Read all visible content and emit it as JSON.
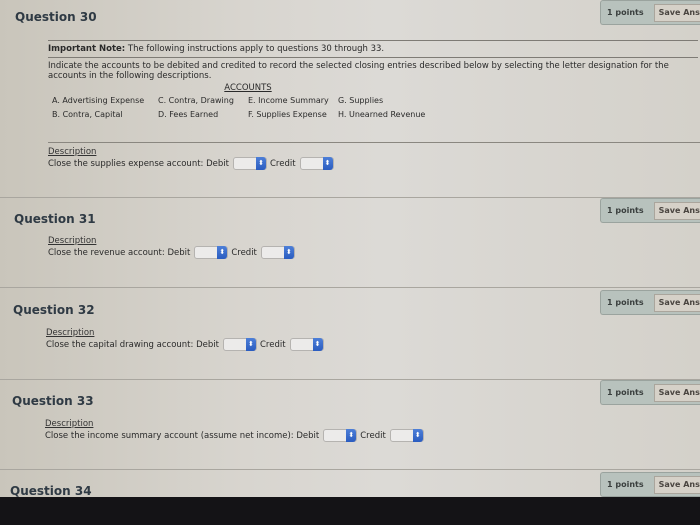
{
  "questions": [
    {
      "title": "Question 30",
      "points": "1 points",
      "save_label": "Save Answer",
      "description_label": "Description",
      "prompt": "Close the supplies expense account:",
      "debit_label": "Debit",
      "credit_label": "Credit",
      "debit_value": "",
      "credit_value": ""
    },
    {
      "title": "Question 31",
      "points": "1 points",
      "save_label": "Save Answer",
      "description_label": "Description",
      "prompt": "Close the revenue account:",
      "debit_label": "Debit",
      "credit_label": "Credit",
      "debit_value": "",
      "credit_value": ""
    },
    {
      "title": "Question 32",
      "points": "1 points",
      "save_label": "Save Answer",
      "description_label": "Description",
      "prompt": "Close the capital drawing account:",
      "debit_label": "Debit",
      "credit_label": "Credit",
      "debit_value": "",
      "credit_value": ""
    },
    {
      "title": "Question 33",
      "points": "1 points",
      "save_label": "Save Answer",
      "description_label": "Description",
      "prompt": "Close the income summary account (assume net income):",
      "debit_label": "Debit",
      "credit_label": "Credit",
      "debit_value": "",
      "credit_value": ""
    },
    {
      "title": "Question 34",
      "points": "1 points",
      "save_label": "Save Answer"
    }
  ],
  "note": {
    "bold": "Important Note:",
    "text": " The following instructions apply to questions 30 through 33."
  },
  "instructions": "Indicate the accounts to be debited and credited to record the selected closing entries described below by selecting the letter designation for the accounts in the following descriptions.",
  "accounts": {
    "title": "ACCOUNTS",
    "items": [
      "A. Advertising Expense",
      "C. Contra, Drawing",
      "E. Income Summary",
      "G. Supplies",
      "B. Contra, Capital",
      "D. Fees Earned",
      "F. Supplies Expense",
      "H. Unearned Revenue"
    ]
  },
  "icons": {
    "select_arrow": "⬍"
  },
  "colors": {
    "select_accent": "#2a5cc0",
    "points_bg": "#b8c2bd",
    "bottom_bar": "#141316"
  }
}
